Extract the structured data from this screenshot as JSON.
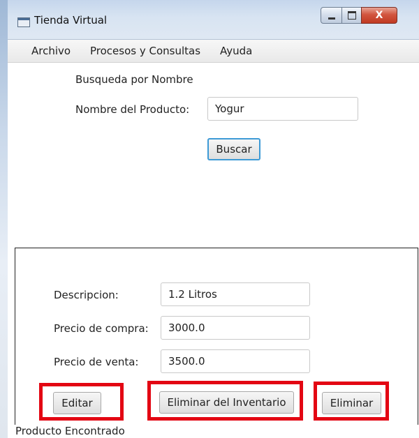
{
  "window": {
    "title": "Tienda Virtual",
    "controls": {
      "minimize": "minimize",
      "maximize": "maximize",
      "close": "X"
    }
  },
  "menu": [
    "Archivo",
    "Procesos y Consultas",
    "Ayuda"
  ],
  "search": {
    "section_label": "Busqueda por Nombre",
    "name_label": "Nombre del Producto:",
    "name_value": "Yogur",
    "search_button": "Buscar"
  },
  "details": {
    "description_label": "Descripcion:",
    "description_value": "1.2 Litros",
    "purchase_price_label": "Precio de compra:",
    "purchase_price_value": "3000.0",
    "sale_price_label": "Precio de venta:",
    "sale_price_value": "3500.0"
  },
  "actions": {
    "edit": "Editar",
    "remove_from_inventory": "Eliminar del Inventario",
    "delete": "Eliminar"
  },
  "status": "Producto Encontrado",
  "colors": {
    "highlight": "#e30613",
    "focus_border": "#3d9ad6",
    "titlebar": "#d8e4f2"
  }
}
